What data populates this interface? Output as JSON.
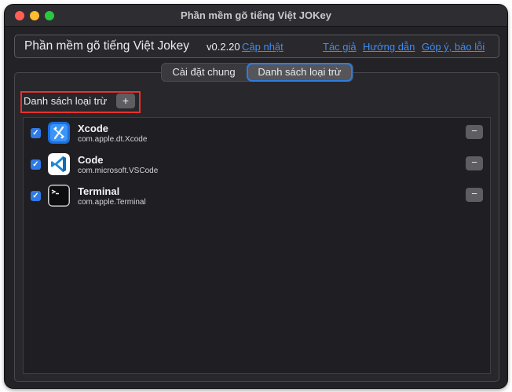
{
  "window": {
    "title": "Phần mềm gõ tiếng Việt JOKey"
  },
  "header": {
    "app_name": "Phần mềm gõ tiếng Việt Jokey",
    "version": "v0.2.20",
    "update_link": "Cập nhật",
    "author_link": "Tác giả",
    "guide_link": "Hướng dẫn",
    "feedback_link": "Góp ý, báo lỗi"
  },
  "tabs": [
    {
      "label": "Cài đặt chung",
      "selected": false
    },
    {
      "label": "Danh sách loại trừ",
      "selected": true
    }
  ],
  "exclusion": {
    "label": "Danh sách loại trừ",
    "add_label": "+",
    "remove_label": "−",
    "apps": [
      {
        "name": "Xcode",
        "bundle_id": "com.apple.dt.Xcode",
        "checked": true,
        "icon": "xcode-icon"
      },
      {
        "name": "Code",
        "bundle_id": "com.microsoft.VSCode",
        "checked": true,
        "icon": "vscode-icon"
      },
      {
        "name": "Terminal",
        "bundle_id": "com.apple.Terminal",
        "checked": true,
        "icon": "terminal-icon"
      }
    ]
  },
  "colors": {
    "accent": "#2f7ae5",
    "link": "#3d8df5",
    "highlight": "#e8322a"
  }
}
